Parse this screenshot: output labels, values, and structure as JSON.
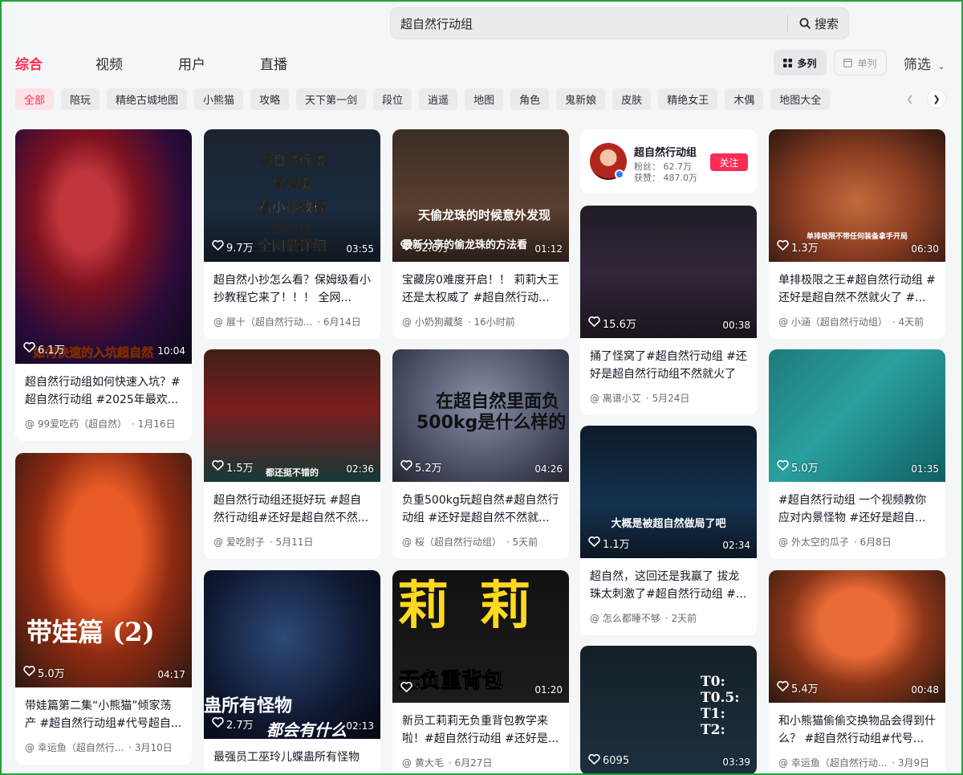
{
  "search": {
    "value": "超自然行动组",
    "button_label": "搜索"
  },
  "tabs": [
    {
      "label": "综合",
      "active": true
    },
    {
      "label": "视频",
      "active": false
    },
    {
      "label": "用户",
      "active": false
    },
    {
      "label": "直播",
      "active": false
    }
  ],
  "layout": {
    "multi_label": "多列",
    "single_label": "单列",
    "filter_label": "筛选"
  },
  "chips": [
    "全部",
    "陪玩",
    "精绝古城地图",
    "小熊猫",
    "攻略",
    "天下第一剑",
    "段位",
    "逍遥",
    "地图",
    "角色",
    "鬼新娘",
    "皮肤",
    "精绝女王",
    "木偶",
    "地图大全"
  ],
  "profile": {
    "name": "超自然行动组",
    "fans": "粉丝：  62.7万",
    "likes": "获赞：  487.0万",
    "follow_label": "关注"
  },
  "cards": [
    {
      "likes": "6.1万",
      "duration": "10:04",
      "title": "超自然行动组如何快速入坑？#超自然行动组 #2025年最欢...",
      "author": "@ 99爱吃药（超自然）",
      "date": "· 1月16日",
      "overlay": "如何快速的入坑超自然"
    },
    {
      "likes": "5.0万",
      "duration": "04:17",
      "title": "带娃篇第二集“小熊猫”倾家荡产 #超自然行动组#代号超自...",
      "author": "@ 幸运鱼（超自然行...",
      "date": "· 3月10日",
      "overlay": "带娃篇 (2)"
    },
    {
      "likes": "9.7万",
      "duration": "03:55",
      "title": "超自然小抄怎么看？保姆级看小抄教程它来了！！！ 全网...",
      "author": "@ 展十（超自然行动...",
      "date": "· 6月14日",
      "overlay": [
        "超自然行动",
        "保姆级",
        "看小抄教程",
        "内有小抄",
        "全网最详细"
      ]
    },
    {
      "likes": "1.5万",
      "duration": "02:36",
      "title": "超自然行动组还挺好玩 #超自然行动组#还好是超自然不然...",
      "author": "@ 爱吃肘子",
      "date": "· 5月11日",
      "overlay": "都还挺不错的"
    },
    {
      "likes": "2.7万",
      "duration": "02:13",
      "title": "最强员工巫玲儿蝶蛊所有怪物",
      "author": "",
      "date": "",
      "overlay": [
        "蛊所有怪物",
        "都会有什么"
      ]
    },
    {
      "likes": "32.6万",
      "duration": "01:12",
      "title": "宝藏房0难度开启！！ 莉莉大王还是太权威了 #超自然行动...",
      "author": "@ 小奶狗藏獒",
      "date": "· 16小时前",
      "overlay": [
        "天偷龙珠的时候意外发现",
        "最新分享的偷龙珠的方法看"
      ]
    },
    {
      "likes": "5.2万",
      "duration": "04:26",
      "title": "负重500kg玩超自然#超自然行动组 #还好是超自然不然就...",
      "author": "@ 桜（超自然行动组）",
      "date": "· 5天前",
      "overlay": [
        "在超自然里面负",
        "500kg是什么样的"
      ]
    },
    {
      "likes": "",
      "duration": "01:20",
      "title": "新员工莉莉无负重背包教学来啦！#超自然行动组 #还好是...",
      "author": "@ 黄大毛",
      "date": "· 6月27日",
      "overlay": [
        "莉  莉",
        "无负重背包"
      ]
    },
    {
      "likes": "15.6万",
      "duration": "00:38",
      "title": "捅了怪窝了#超自然行动组 #还好是超自然行动组不然就火了",
      "author": "@ 离谱小艾",
      "date": "· 5月24日",
      "overlay": ""
    },
    {
      "likes": "1.1万",
      "duration": "02:34",
      "title": "超自然，这回还是我赢了 拔龙珠太刺激了#超自然行动组 #...",
      "author": "@ 怎么都睡不够",
      "date": "· 2天前",
      "overlay": "大概是被超自然做局了吧"
    },
    {
      "likes": "6095",
      "duration": "03:39",
      "title": "",
      "author": "",
      "date": "",
      "overlay": [
        "T0:",
        "T0.5:",
        "T1:",
        "T2:"
      ]
    },
    {
      "likes": "1.3万",
      "duration": "06:30",
      "title": "单排极限之王#超自然行动组 #还好是超自然不然就火了 #...",
      "author": "@ 小涵（超自然行动组）",
      "date": "· 4天前",
      "overlay": "单排极限不带任何装备拿手开局"
    },
    {
      "likes": "5.0万",
      "duration": "01:35",
      "title": "#超自然行动组 一个视频教你应对内景怪物 #还好是超自...",
      "author": "@ 外太空的瓜子",
      "date": "· 6月8日",
      "overlay": ""
    },
    {
      "likes": "5.4万",
      "duration": "00:48",
      "title": "和小熊猫偷偷交换物品会得到什么？ #超自然行动组#代号...",
      "author": "@ 幸运鱼（超自然行动...",
      "date": "· 3月9日",
      "overlay": ""
    }
  ]
}
